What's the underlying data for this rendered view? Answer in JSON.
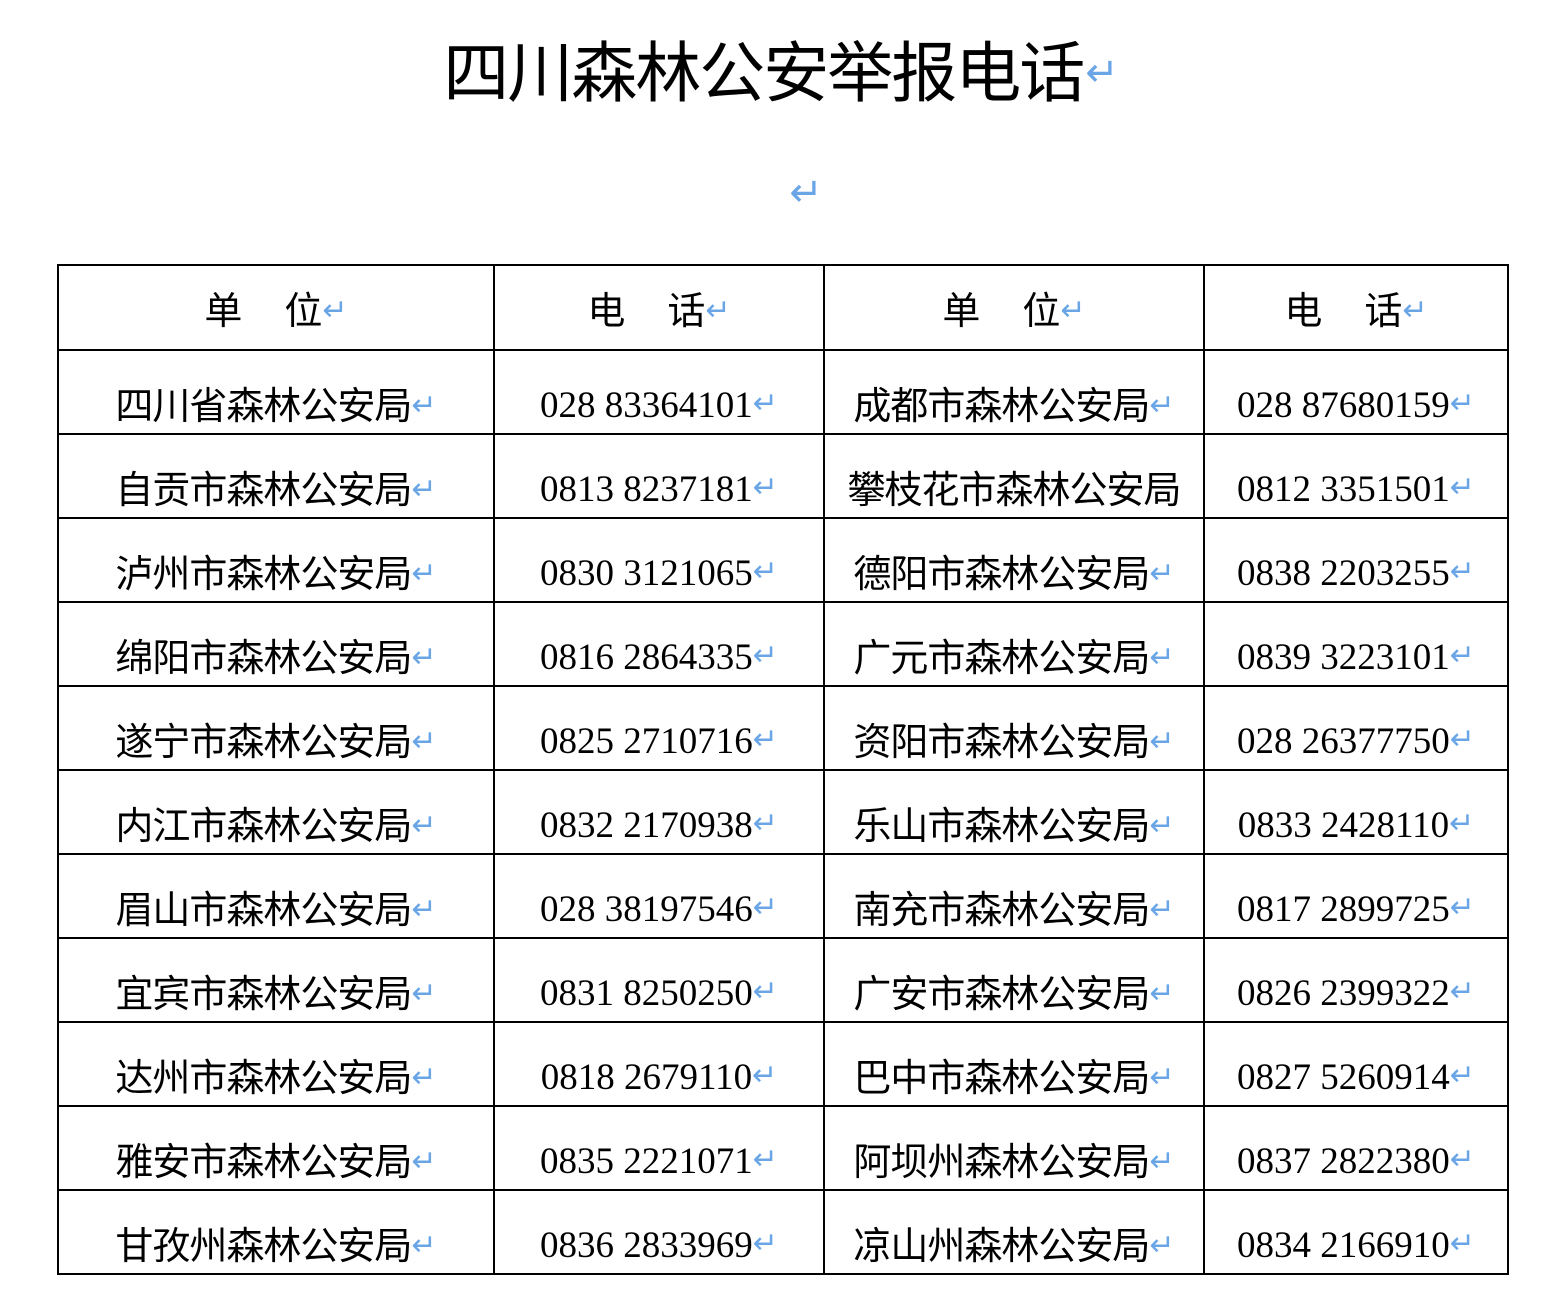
{
  "title": "四川森林公安举报电话",
  "paragraph_mark": "↵",
  "table": {
    "headers": [
      "单位",
      "电话",
      "单位",
      "电话"
    ],
    "rows": [
      {
        "unit_a": "四川省森林公安局",
        "phone_a": "028 83364101",
        "unit_b": "成都市森林公安局",
        "phone_b": "028 87680159"
      },
      {
        "unit_a": "自贡市森林公安局",
        "phone_a": "0813 8237181",
        "unit_b": "攀枝花市森林公安局",
        "phone_b": "0812 3351501"
      },
      {
        "unit_a": "泸州市森林公安局",
        "phone_a": "0830 3121065",
        "unit_b": "德阳市森林公安局",
        "phone_b": "0838 2203255"
      },
      {
        "unit_a": "绵阳市森林公安局",
        "phone_a": "0816 2864335",
        "unit_b": "广元市森林公安局",
        "phone_b": "0839 3223101"
      },
      {
        "unit_a": "遂宁市森林公安局",
        "phone_a": "0825 2710716",
        "unit_b": "资阳市森林公安局",
        "phone_b": "028 26377750"
      },
      {
        "unit_a": "内江市森林公安局",
        "phone_a": "0832 2170938",
        "unit_b": "乐山市森林公安局",
        "phone_b": "0833 2428110"
      },
      {
        "unit_a": "眉山市森林公安局",
        "phone_a": "028 38197546",
        "unit_b": "南充市森林公安局",
        "phone_b": "0817 2899725"
      },
      {
        "unit_a": "宜宾市森林公安局",
        "phone_a": "0831 8250250",
        "unit_b": "广安市森林公安局",
        "phone_b": "0826 2399322"
      },
      {
        "unit_a": "达州市森林公安局",
        "phone_a": "0818 2679110",
        "unit_b": "巴中市森林公安局",
        "phone_b": "0827 5260914"
      },
      {
        "unit_a": "雅安市森林公安局",
        "phone_a": "0835 2221071",
        "unit_b": "阿坝州森林公安局",
        "phone_b": "0837 2822380"
      },
      {
        "unit_a": "甘孜州森林公安局",
        "phone_a": "0836 2833969",
        "unit_b": "凉山州森林公安局",
        "phone_b": "0834 2166910"
      }
    ]
  }
}
